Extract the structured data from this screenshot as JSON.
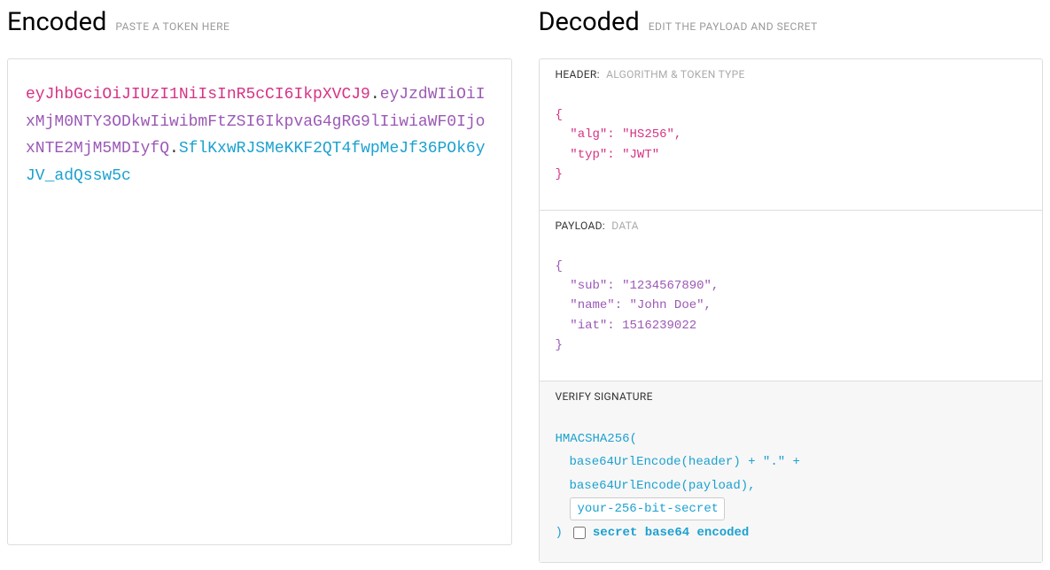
{
  "encoded": {
    "title": "Encoded",
    "subtitle": "PASTE A TOKEN HERE",
    "token_header": "eyJhbGciOiJIUzI1NiIsInR5cCI6IkpXVCJ9",
    "token_payload": "eyJzdWIiOiIxMjM0NTY3ODkwIiwibmFtZSI6IkpvaG4gRG9lIiwiaWF0IjoxNTE2MjM5MDIyfQ",
    "token_signature": "SflKxwRJSMeKKF2QT4fwpMeJf36POk6yJV_adQssw5c",
    "dot": "."
  },
  "decoded": {
    "title": "Decoded",
    "subtitle": "EDIT THE PAYLOAD AND SECRET",
    "header_section": {
      "label": "HEADER:",
      "sublabel": "ALGORITHM & TOKEN TYPE",
      "json": "{\n  \"alg\": \"HS256\",\n  \"typ\": \"JWT\"\n}"
    },
    "payload_section": {
      "label": "PAYLOAD:",
      "sublabel": "DATA",
      "json": "{\n  \"sub\": \"1234567890\",\n  \"name\": \"John Doe\",\n  \"iat\": 1516239022\n}"
    },
    "signature_section": {
      "label": "VERIFY SIGNATURE",
      "line1": "HMACSHA256(",
      "line2": "base64UrlEncode(header) + \".\" +",
      "line3": "base64UrlEncode(payload),",
      "secret_value": "your-256-bit-secret",
      "close_paren": ")",
      "checkbox_label": "secret base64 encoded"
    }
  }
}
